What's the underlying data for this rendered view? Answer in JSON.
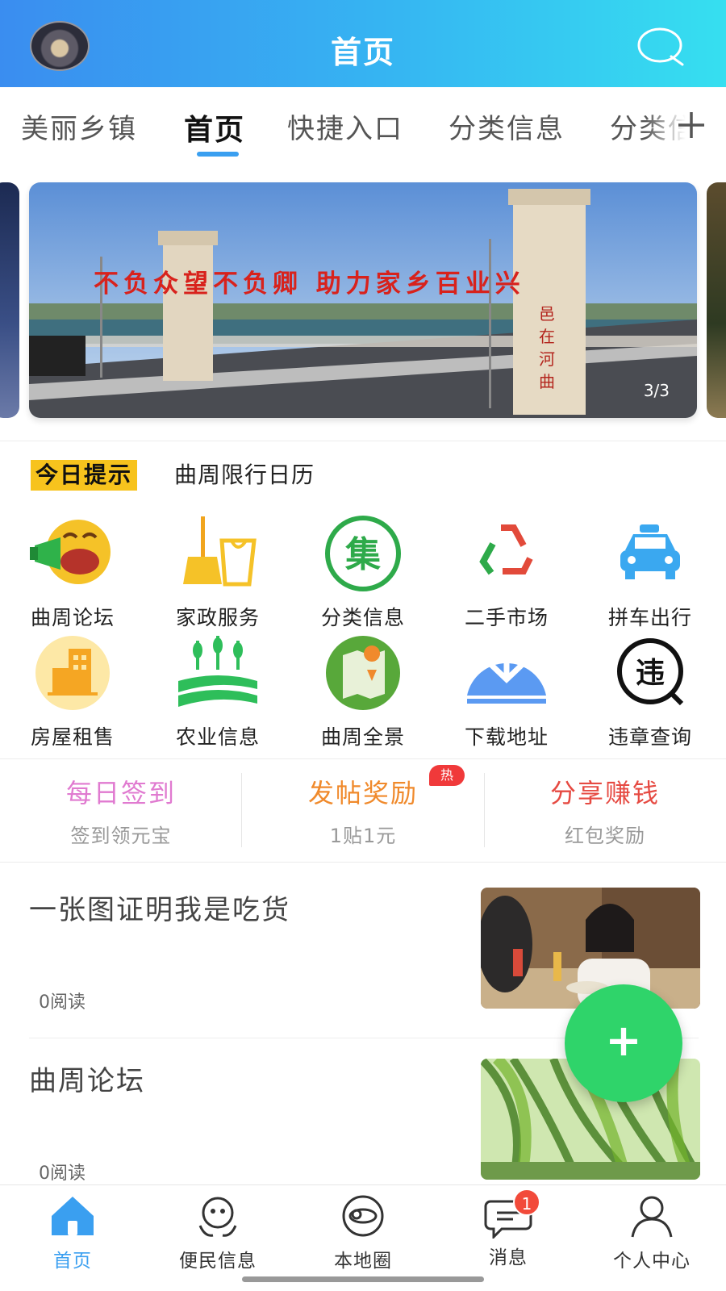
{
  "header": {
    "title": "首页"
  },
  "tabs": [
    {
      "label": "美丽乡镇"
    },
    {
      "label": "首页"
    },
    {
      "label": "快捷入口"
    },
    {
      "label": "分类信息"
    },
    {
      "label": "分类信息"
    }
  ],
  "banner": {
    "caption": "不负众望不负卿  助力家乡百业兴",
    "counter": "3/3"
  },
  "tip": {
    "badge": "今日提示",
    "text": "曲周限行日历"
  },
  "grid": [
    {
      "label": "曲周论坛",
      "icon": "laughing-face-megaphone-icon"
    },
    {
      "label": "家政服务",
      "icon": "broom-bucket-icon"
    },
    {
      "label": "分类信息",
      "icon": "ji-circle-icon"
    },
    {
      "label": "二手市场",
      "icon": "recycle-icon"
    },
    {
      "label": "拼车出行",
      "icon": "car-icon"
    },
    {
      "label": "房屋租售",
      "icon": "building-icon"
    },
    {
      "label": "农业信息",
      "icon": "wheat-field-icon"
    },
    {
      "label": "曲周全景",
      "icon": "map-pin-icon"
    },
    {
      "label": "下载地址",
      "icon": "download-icon"
    },
    {
      "label": "违章查询",
      "icon": "violation-bubble-icon"
    }
  ],
  "promos": [
    {
      "title": "每日签到",
      "sub": "签到领元宝",
      "color": "#e07ad0"
    },
    {
      "title": "发帖奖励",
      "sub": "1贴1元",
      "color": "#f08a2c",
      "badge": "热"
    },
    {
      "title": "分享赚钱",
      "sub": "红包奖励",
      "color": "#e64a42"
    }
  ],
  "news": [
    {
      "title": "一张图证明我是吃货",
      "reads": "0阅读"
    },
    {
      "title": "曲周论坛",
      "reads": "0阅读"
    }
  ],
  "fab": {
    "label": "+"
  },
  "bottom_nav": [
    {
      "label": "首页",
      "icon": "home-icon",
      "active": true
    },
    {
      "label": "便民信息",
      "icon": "service-people-icon"
    },
    {
      "label": "本地圈",
      "icon": "planet-icon"
    },
    {
      "label": "消息",
      "icon": "message-icon",
      "badge": "1"
    },
    {
      "label": "个人中心",
      "icon": "person-icon"
    }
  ],
  "colors": {
    "header_start": "#3a8df0",
    "header_end": "#36dff0",
    "accent": "#3a9ff0",
    "fab": "#2fd46a",
    "tip_badge": "#f7c31d"
  }
}
